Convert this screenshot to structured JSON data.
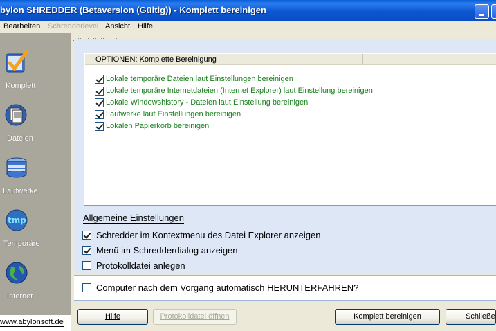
{
  "window": {
    "title": "bylon SHREDDER (Betaversion (Gültig)) - Komplett bereinigen"
  },
  "menu": [
    "Bearbeiten",
    "Schredderlevel",
    "Ansicht",
    "Hilfe"
  ],
  "menu_disabled": [
    false,
    true,
    false,
    false
  ],
  "sidebar": {
    "items": [
      {
        "label": "Komplett",
        "icon": "checkmark-icon"
      },
      {
        "label": "Dateien",
        "icon": "files-icon"
      },
      {
        "label": "Laufwerke",
        "icon": "drive-icon"
      },
      {
        "label": "Temporäre",
        "icon": "tmp-icon"
      },
      {
        "label": "Internet",
        "icon": "globe-icon"
      }
    ],
    "website": "www.abylonsoft.de"
  },
  "options_list": {
    "header": "OPTIONEN: Komplette Bereinigung",
    "rows": [
      {
        "label": "Lokale temporäre Dateien laut Einstellungen bereinigen",
        "checked": true
      },
      {
        "label": "Lokale temporäre Internetdateien (Internet Explorer) laut Einstellung bereinigen",
        "checked": true
      },
      {
        "label": "Lokale Windowshistory - Dateien laut Einstellung bereinigen",
        "checked": true
      },
      {
        "label": "Laufwerke laut Einstellungen bereinigen",
        "checked": true
      },
      {
        "label": "Lokalen Papierkorb bereinigen",
        "checked": true
      }
    ],
    "row_color": "#17801b"
  },
  "general_settings": {
    "title": "Allgemeine Einstellungen",
    "options": [
      {
        "label": "Schredder im Kontextmenu des Datei Explorer anzeigen",
        "checked": true
      },
      {
        "label": "Menü im Schredderdialog anzeigen",
        "checked": true
      },
      {
        "label": "Protokolldatei anlegen",
        "checked": false
      }
    ]
  },
  "shutdown": {
    "label": "Computer nach dem Vorgang automatisch HERUNTERFAHREN?",
    "checked": false
  },
  "buttons": {
    "help": "Hilfe",
    "open_log": "Protokolldatei öffnen",
    "clean_all": "Komplett bereinigen",
    "close": "Schließen"
  },
  "colors": {
    "titlebar": "#0b57d0",
    "sidebar": "#a9a79b",
    "panel": "#dde7f5"
  }
}
